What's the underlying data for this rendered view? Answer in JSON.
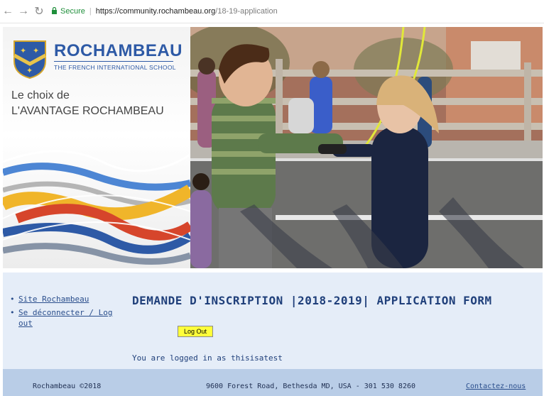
{
  "browser": {
    "secure_label": "Secure",
    "url_host": "https://community.rochambeau.org",
    "url_path": "/18-19-application"
  },
  "brand": {
    "name": "ROCHAMBEAU",
    "subtitle": "THE FRENCH INTERNATIONAL SCHOOL",
    "tagline_line1": "Le choix de",
    "tagline_line2": "L'AVANTAGE ROCHAMBEAU",
    "color": "#2e5aa6"
  },
  "nav": {
    "items": [
      {
        "label": "Site Rochambeau"
      },
      {
        "label": "Se déconnecter / Log out"
      }
    ]
  },
  "main": {
    "heading": "DEMANDE D'INSCRIPTION |2018-2019| APPLICATION FORM",
    "logout_label": "Log Out",
    "logged_in_text": "You are logged in as thisisatest"
  },
  "footer": {
    "left": "Rochambeau ©2018",
    "address": "9600 Forest Road, Bethesda MD, USA - 301 530 8260",
    "contact": "Contactez-nous"
  },
  "colors": {
    "content_bg": "#e5edf8",
    "footer_bg": "#b9cde7",
    "button_bg": "#ffff3a",
    "heading": "#1f3f7a"
  }
}
